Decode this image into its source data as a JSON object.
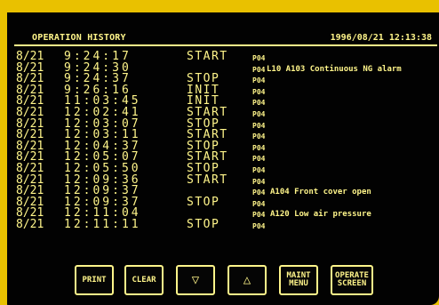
{
  "header": {
    "title": "OPERATION HISTORY",
    "datetime": "1996/08/21 12:13:38"
  },
  "log": [
    {
      "date": "8/21",
      "time": "9:24:17",
      "event": "START",
      "code": "P04",
      "alarm": ""
    },
    {
      "date": "8/21",
      "time": "9:24:30",
      "event": "",
      "code": "P04",
      "alarm": "L10 A103 Continuous NG alarm"
    },
    {
      "date": "8/21",
      "time": "9:24:37",
      "event": "STOP",
      "code": "P04",
      "alarm": ""
    },
    {
      "date": "8/21",
      "time": "9:26:16",
      "event": "INIT",
      "code": "P04",
      "alarm": ""
    },
    {
      "date": "8/21",
      "time": "11:03:45",
      "event": "INIT",
      "code": "P04",
      "alarm": ""
    },
    {
      "date": "8/21",
      "time": "12:02:41",
      "event": "START",
      "code": "P04",
      "alarm": ""
    },
    {
      "date": "8/21",
      "time": "12:03:07",
      "event": "STOP",
      "code": "P04",
      "alarm": ""
    },
    {
      "date": "8/21",
      "time": "12:03:11",
      "event": "START",
      "code": "P04",
      "alarm": ""
    },
    {
      "date": "8/21",
      "time": "12:04:37",
      "event": "STOP",
      "code": "P04",
      "alarm": ""
    },
    {
      "date": "8/21",
      "time": "12:05:07",
      "event": "START",
      "code": "P04",
      "alarm": ""
    },
    {
      "date": "8/21",
      "time": "12:05:50",
      "event": "STOP",
      "code": "P04",
      "alarm": ""
    },
    {
      "date": "8/21",
      "time": "12:09:36",
      "event": "START",
      "code": "P04",
      "alarm": ""
    },
    {
      "date": "8/21",
      "time": "12:09:37",
      "event": "",
      "code": "P04",
      "alarm": "A104 Front cover open"
    },
    {
      "date": "8/21",
      "time": "12:09:37",
      "event": "STOP",
      "code": "P04",
      "alarm": ""
    },
    {
      "date": "8/21",
      "time": "12:11:04",
      "event": "",
      "code": "P04",
      "alarm": "A120 Low air pressure"
    },
    {
      "date": "8/21",
      "time": "12:11:11",
      "event": "STOP",
      "code": "P04",
      "alarm": ""
    }
  ],
  "buttons": {
    "print": "PRINT",
    "clear": "CLEAR",
    "down": "▽",
    "up": "△",
    "maint_line1": "MAINT",
    "maint_line2": "MENU",
    "operate_line1": "OPERATE",
    "operate_line2": "SCREEN"
  },
  "colors": {
    "text": "#fff58a",
    "background": "#020202",
    "bezel": "#e9c100"
  }
}
